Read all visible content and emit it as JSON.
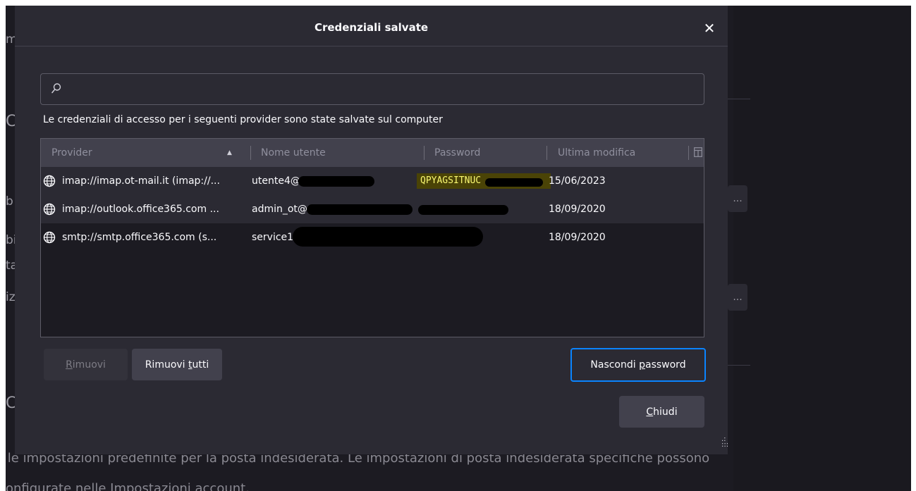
{
  "dialog": {
    "title": "Credenziali salvate",
    "close_glyph": "✕",
    "search": {
      "placeholder": "",
      "value": ""
    },
    "description": "Le credenziali di accesso per i seguenti provider sono state salvate sul computer",
    "columns": [
      "Provider",
      "Nome utente",
      "Password",
      "Ultima modifica"
    ],
    "sort": {
      "column": "Provider",
      "direction": "ascending"
    },
    "rows": [
      {
        "provider": "imap://imap.ot-mail.it (imap://...",
        "username": "utente4@",
        "password": "QPYAGSITNUC",
        "modified": "15/06/2023",
        "selected": true
      },
      {
        "provider": "imap://outlook.office365.com ...",
        "username": "admin_ot@",
        "password": "",
        "modified": "18/09/2020",
        "selected": false
      },
      {
        "provider": "smtp://smtp.office365.com (s...",
        "username": "service1",
        "password": "",
        "modified": "18/09/2020",
        "selected": false
      }
    ],
    "buttons": {
      "remove": {
        "pre": "",
        "accel": "R",
        "post": "imuovi",
        "enabled": false
      },
      "remove_all": {
        "pre": "Rimuovi ",
        "accel": "t",
        "post": "utti"
      },
      "toggle_password": {
        "pre": "Nascondi ",
        "accel": "p",
        "post": "assword"
      },
      "close": {
        "pre": "",
        "accel": "C",
        "post": "hiudi"
      }
    }
  },
  "background": {
    "line1": "e le impostazioni predefinite per la posta indesiderata. Le impostazioni di posta indesiderata specifiche possono",
    "line2": "onfigurate nelle Impostazioni account.",
    "fragments": [
      "m",
      "C",
      "b",
      "bi",
      "ta",
      "iz",
      "C"
    ],
    "ellipsis": "..."
  },
  "icons": {
    "search": "search-icon",
    "sort": "sort-ascending-icon",
    "column_picker": "column-picker-icon",
    "globe": "globe-icon",
    "close": "close-icon",
    "resize": "resize-grip-icon"
  },
  "colors": {
    "accent": "#0a84ff",
    "dialog_bg": "#2b2a33",
    "password_highlight_text": "#f9f871"
  }
}
